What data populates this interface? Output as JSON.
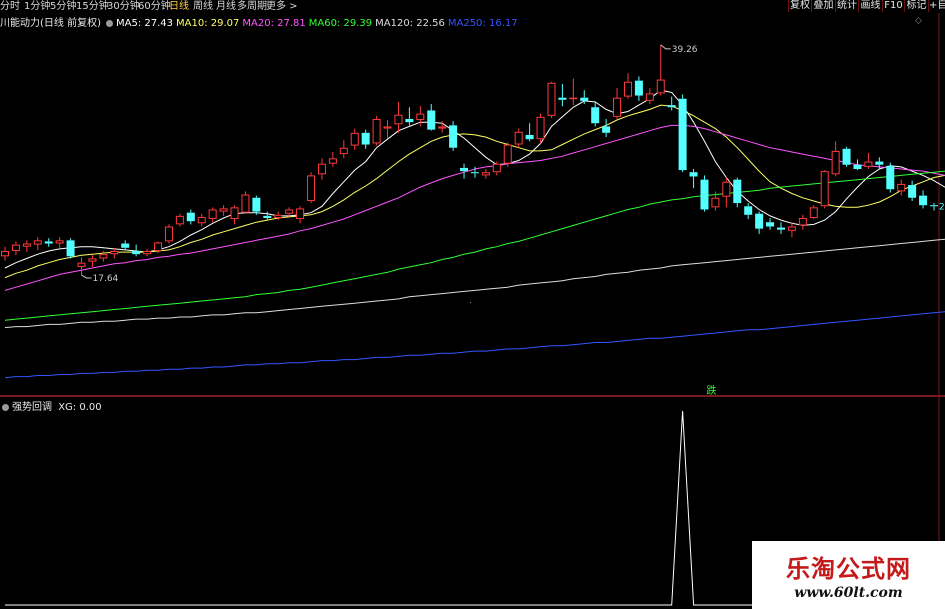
{
  "toolbar": {
    "periods": [
      "分时",
      "1分钟",
      "5分钟",
      "15分钟",
      "30分钟",
      "60分钟",
      "日线",
      "周线",
      "月线",
      "多周期",
      "更多 >"
    ],
    "active_period": "日线",
    "right_buttons": [
      "复权",
      "叠加",
      "统计",
      "画线",
      "F10",
      "标记",
      "+自"
    ]
  },
  "main_info": {
    "title": "川能动力(日线 前复权)",
    "ma": [
      {
        "label": "MA5: 27.43",
        "color": "#ffffff"
      },
      {
        "label": "MA10: 29.07",
        "color": "#ffff66"
      },
      {
        "label": "MA20: 27.81",
        "color": "#ff55ff"
      },
      {
        "label": "MA60: 29.39",
        "color": "#33ff33"
      },
      {
        "label": "MA120: 22.56",
        "color": "#dddddd"
      },
      {
        "label": "MA250: 16.17",
        "color": "#3355ff"
      }
    ]
  },
  "annotations": {
    "high": "39.26",
    "low": "17.64",
    "signal": "跌",
    "right_marker": "2"
  },
  "indicator": {
    "title": "强势回调",
    "value": "XG: 0.00"
  },
  "watermark": {
    "title": "乐淘公式网",
    "url": "www.60lt.com"
  },
  "chart_data": {
    "type": "candlestick",
    "candles": [
      {
        "o": 19.4,
        "h": 20.3,
        "l": 19.0,
        "c": 19.9
      },
      {
        "o": 19.9,
        "h": 20.8,
        "l": 19.5,
        "c": 20.5
      },
      {
        "o": 20.3,
        "h": 20.9,
        "l": 19.8,
        "c": 20.6
      },
      {
        "o": 20.5,
        "h": 21.2,
        "l": 20.0,
        "c": 20.9
      },
      {
        "o": 20.8,
        "h": 21.1,
        "l": 20.3,
        "c": 20.6
      },
      {
        "o": 20.6,
        "h": 21.2,
        "l": 20.2,
        "c": 20.9
      },
      {
        "o": 20.9,
        "h": 21.1,
        "l": 19.2,
        "c": 19.4
      },
      {
        "o": 18.4,
        "h": 19.3,
        "l": 17.64,
        "c": 18.8
      },
      {
        "o": 18.9,
        "h": 19.5,
        "l": 18.4,
        "c": 19.2
      },
      {
        "o": 19.2,
        "h": 19.9,
        "l": 18.9,
        "c": 19.6
      },
      {
        "o": 19.6,
        "h": 20.2,
        "l": 19.2,
        "c": 19.9
      },
      {
        "o": 20.6,
        "h": 20.9,
        "l": 20.0,
        "c": 20.2
      },
      {
        "o": 19.9,
        "h": 20.5,
        "l": 19.4,
        "c": 19.6
      },
      {
        "o": 19.6,
        "h": 20.1,
        "l": 19.4,
        "c": 19.9
      },
      {
        "o": 19.9,
        "h": 20.8,
        "l": 19.7,
        "c": 20.7
      },
      {
        "o": 20.8,
        "h": 22.4,
        "l": 20.6,
        "c": 22.2
      },
      {
        "o": 22.4,
        "h": 23.4,
        "l": 22.2,
        "c": 23.2
      },
      {
        "o": 23.5,
        "h": 23.8,
        "l": 22.4,
        "c": 22.7
      },
      {
        "o": 22.5,
        "h": 23.4,
        "l": 22.2,
        "c": 23.1
      },
      {
        "o": 22.9,
        "h": 24.0,
        "l": 22.6,
        "c": 23.8
      },
      {
        "o": 23.6,
        "h": 24.2,
        "l": 23.2,
        "c": 23.9
      },
      {
        "o": 22.9,
        "h": 24.2,
        "l": 22.4,
        "c": 24.0
      },
      {
        "o": 23.5,
        "h": 25.5,
        "l": 23.4,
        "c": 25.2
      },
      {
        "o": 24.9,
        "h": 25.1,
        "l": 23.3,
        "c": 23.6
      },
      {
        "o": 23.2,
        "h": 23.6,
        "l": 22.8,
        "c": 23.0
      },
      {
        "o": 23.0,
        "h": 23.6,
        "l": 22.8,
        "c": 23.3
      },
      {
        "o": 23.4,
        "h": 24.0,
        "l": 23.1,
        "c": 23.8
      },
      {
        "o": 22.9,
        "h": 24.1,
        "l": 22.5,
        "c": 23.9
      },
      {
        "o": 24.6,
        "h": 27.3,
        "l": 24.4,
        "c": 27.0
      },
      {
        "o": 27.1,
        "h": 28.6,
        "l": 26.6,
        "c": 28.1
      },
      {
        "o": 28.1,
        "h": 29.2,
        "l": 27.8,
        "c": 28.6
      },
      {
        "o": 29.0,
        "h": 30.3,
        "l": 28.6,
        "c": 29.6
      },
      {
        "o": 29.8,
        "h": 31.4,
        "l": 29.4,
        "c": 31.0
      },
      {
        "o": 31.0,
        "h": 31.3,
        "l": 29.5,
        "c": 29.9
      },
      {
        "o": 30.0,
        "h": 32.6,
        "l": 29.8,
        "c": 32.3
      },
      {
        "o": 31.4,
        "h": 32.2,
        "l": 30.5,
        "c": 31.6
      },
      {
        "o": 31.8,
        "h": 33.9,
        "l": 31.0,
        "c": 32.7
      },
      {
        "o": 32.3,
        "h": 33.4,
        "l": 31.7,
        "c": 32.0
      },
      {
        "o": 32.2,
        "h": 33.5,
        "l": 31.6,
        "c": 32.8
      },
      {
        "o": 33.1,
        "h": 33.7,
        "l": 31.2,
        "c": 31.3
      },
      {
        "o": 31.4,
        "h": 32.1,
        "l": 31.0,
        "c": 31.6
      },
      {
        "o": 31.7,
        "h": 32.1,
        "l": 29.3,
        "c": 29.6
      },
      {
        "o": 27.7,
        "h": 28.1,
        "l": 26.7,
        "c": 27.4
      },
      {
        "o": 27.3,
        "h": 27.8,
        "l": 26.8,
        "c": 27.2
      },
      {
        "o": 27.0,
        "h": 27.6,
        "l": 26.7,
        "c": 27.3
      },
      {
        "o": 27.3,
        "h": 28.3,
        "l": 27.0,
        "c": 28.1
      },
      {
        "o": 28.1,
        "h": 30.1,
        "l": 27.8,
        "c": 29.9
      },
      {
        "o": 29.9,
        "h": 31.4,
        "l": 29.6,
        "c": 31.1
      },
      {
        "o": 30.8,
        "h": 31.9,
        "l": 30.2,
        "c": 30.4
      },
      {
        "o": 30.4,
        "h": 32.8,
        "l": 30.0,
        "c": 32.5
      },
      {
        "o": 32.6,
        "h": 35.8,
        "l": 32.4,
        "c": 35.7
      },
      {
        "o": 34.3,
        "h": 35.6,
        "l": 33.5,
        "c": 34.1
      },
      {
        "o": 34.2,
        "h": 36.1,
        "l": 33.6,
        "c": 34.3
      },
      {
        "o": 34.3,
        "h": 35.0,
        "l": 33.7,
        "c": 34.0
      },
      {
        "o": 33.4,
        "h": 33.9,
        "l": 31.6,
        "c": 31.9
      },
      {
        "o": 31.6,
        "h": 32.3,
        "l": 30.6,
        "c": 31.0
      },
      {
        "o": 32.5,
        "h": 35.2,
        "l": 32.3,
        "c": 34.3
      },
      {
        "o": 34.4,
        "h": 36.6,
        "l": 34.2,
        "c": 35.8
      },
      {
        "o": 35.9,
        "h": 36.3,
        "l": 34.0,
        "c": 34.5
      },
      {
        "o": 34.0,
        "h": 35.2,
        "l": 33.7,
        "c": 34.7
      },
      {
        "o": 34.7,
        "h": 39.26,
        "l": 34.5,
        "c": 36.0
      },
      {
        "o": 33.6,
        "h": 34.4,
        "l": 33.1,
        "c": 33.4
      },
      {
        "o": 34.2,
        "h": 34.6,
        "l": 27.3,
        "c": 27.5
      },
      {
        "o": 27.3,
        "h": 27.6,
        "l": 25.8,
        "c": 26.9
      },
      {
        "o": 26.6,
        "h": 27.0,
        "l": 23.6,
        "c": 23.8
      },
      {
        "o": 24.0,
        "h": 25.5,
        "l": 23.7,
        "c": 24.9
      },
      {
        "o": 25.0,
        "h": 26.8,
        "l": 24.0,
        "c": 26.4
      },
      {
        "o": 26.6,
        "h": 26.8,
        "l": 24.0,
        "c": 24.4
      },
      {
        "o": 24.1,
        "h": 24.4,
        "l": 22.9,
        "c": 23.3
      },
      {
        "o": 23.4,
        "h": 23.6,
        "l": 21.5,
        "c": 22.0
      },
      {
        "o": 22.6,
        "h": 23.0,
        "l": 21.9,
        "c": 22.2
      },
      {
        "o": 22.1,
        "h": 22.6,
        "l": 21.5,
        "c": 21.9
      },
      {
        "o": 21.8,
        "h": 22.6,
        "l": 21.2,
        "c": 22.2
      },
      {
        "o": 22.3,
        "h": 23.3,
        "l": 21.9,
        "c": 23.0
      },
      {
        "o": 23.0,
        "h": 24.2,
        "l": 22.9,
        "c": 24.0
      },
      {
        "o": 24.1,
        "h": 27.5,
        "l": 23.9,
        "c": 27.4
      },
      {
        "o": 27.1,
        "h": 30.2,
        "l": 26.9,
        "c": 29.3
      },
      {
        "o": 29.5,
        "h": 29.7,
        "l": 27.8,
        "c": 28.0
      },
      {
        "o": 28.0,
        "h": 28.5,
        "l": 27.5,
        "c": 27.6
      },
      {
        "o": 27.8,
        "h": 29.1,
        "l": 27.6,
        "c": 28.3
      },
      {
        "o": 28.3,
        "h": 28.7,
        "l": 27.6,
        "c": 28.0
      },
      {
        "o": 27.9,
        "h": 28.2,
        "l": 25.4,
        "c": 25.7
      },
      {
        "o": 25.5,
        "h": 26.6,
        "l": 25.1,
        "c": 26.2
      },
      {
        "o": 26.1,
        "h": 26.5,
        "l": 24.6,
        "c": 24.9
      },
      {
        "o": 25.1,
        "h": 25.6,
        "l": 23.9,
        "c": 24.2
      },
      {
        "o": 24.2,
        "h": 24.4,
        "l": 23.7,
        "c": 24.1
      }
    ],
    "ma_series": [
      {
        "name": "MA5",
        "color": "#ffffff",
        "values": [
          18.3,
          18.8,
          19.2,
          19.6,
          19.9,
          20.1,
          20.2,
          20.3,
          20.3,
          20.2,
          20.1,
          20.0,
          19.9,
          19.8,
          20.0,
          20.3,
          20.8,
          21.4,
          21.9,
          22.5,
          23.0,
          23.4,
          23.5,
          23.5,
          23.4,
          23.2,
          23.2,
          23.3,
          23.5,
          24.1,
          25.3,
          26.4,
          27.5,
          28.3,
          29.6,
          30.4,
          31.2,
          31.6,
          32.0,
          32.0,
          31.9,
          31.2,
          30.5,
          29.6,
          28.7,
          28.0,
          28.1,
          28.4,
          29.0,
          30.0,
          31.6,
          32.5,
          33.4,
          34.0,
          33.9,
          33.2,
          32.8,
          33.0,
          33.6,
          34.2,
          35.0,
          34.8,
          33.6,
          32.0,
          30.2,
          28.3,
          26.8,
          25.5,
          24.6,
          23.8,
          23.2,
          22.8,
          22.5,
          22.3,
          22.4,
          22.8,
          23.6,
          24.8,
          25.9,
          26.9,
          27.6,
          27.9,
          27.8,
          27.4,
          27.0,
          26.5,
          25.9,
          25.3,
          24.9,
          24.6,
          24.4
        ]
      },
      {
        "name": "MA10",
        "color": "#ffff66",
        "values": [
          17.4,
          17.8,
          18.1,
          18.5,
          18.8,
          19.1,
          19.3,
          19.5,
          19.6,
          19.7,
          19.8,
          19.8,
          19.8,
          19.8,
          19.9,
          20.0,
          20.3,
          20.7,
          21.0,
          21.4,
          21.7,
          22.0,
          22.3,
          22.6,
          22.8,
          23.0,
          23.1,
          23.2,
          23.3,
          23.6,
          24.1,
          24.7,
          25.4,
          26.0,
          26.7,
          27.5,
          28.3,
          29.0,
          29.6,
          30.2,
          30.6,
          30.8,
          30.9,
          30.8,
          30.6,
          30.2,
          29.9,
          29.6,
          29.3,
          29.3,
          29.4,
          29.9,
          30.4,
          30.9,
          31.3,
          31.7,
          32.2,
          32.6,
          32.9,
          33.2,
          33.6,
          33.5,
          33.1,
          32.6,
          32.0,
          31.4,
          30.6,
          29.6,
          28.5,
          27.4,
          26.4,
          25.8,
          25.3,
          24.9,
          24.6,
          24.3,
          24.1,
          24.0,
          24.0,
          24.2,
          24.5,
          25.0,
          25.6,
          26.0,
          26.4,
          26.8,
          27.0,
          27.0,
          26.9,
          26.8,
          26.7
        ]
      },
      {
        "name": "MA20",
        "color": "#ff55ff",
        "values": [
          16.2,
          16.5,
          16.8,
          17.1,
          17.4,
          17.7,
          17.9,
          18.1,
          18.3,
          18.5,
          18.7,
          18.8,
          19.0,
          19.1,
          19.3,
          19.4,
          19.6,
          19.7,
          19.9,
          20.1,
          20.3,
          20.5,
          20.7,
          20.9,
          21.1,
          21.3,
          21.5,
          21.8,
          22.0,
          22.3,
          22.6,
          22.9,
          23.3,
          23.7,
          24.1,
          24.5,
          24.9,
          25.4,
          25.9,
          26.3,
          26.7,
          27.0,
          27.3,
          27.6,
          27.8,
          27.9,
          28.1,
          28.2,
          28.3,
          28.4,
          28.6,
          28.8,
          29.1,
          29.4,
          29.7,
          30.0,
          30.3,
          30.6,
          30.9,
          31.2,
          31.5,
          31.7,
          31.7,
          31.6,
          31.4,
          31.1,
          30.8,
          30.5,
          30.2,
          29.9,
          29.6,
          29.4,
          29.2,
          29.0,
          28.8,
          28.6,
          28.4,
          28.2,
          28.0,
          27.9,
          27.8,
          27.7,
          27.6,
          27.5,
          27.4,
          27.2,
          27.0,
          26.8,
          26.6,
          26.4,
          26.2
        ]
      },
      {
        "name": "MA60",
        "color": "#33ff33",
        "values": [
          13.4,
          13.5,
          13.6,
          13.7,
          13.8,
          13.9,
          14.0,
          14.1,
          14.2,
          14.3,
          14.4,
          14.5,
          14.6,
          14.7,
          14.8,
          14.9,
          15.0,
          15.1,
          15.2,
          15.3,
          15.4,
          15.5,
          15.6,
          15.8,
          15.9,
          16.0,
          16.2,
          16.3,
          16.5,
          16.7,
          16.9,
          17.1,
          17.3,
          17.5,
          17.7,
          17.9,
          18.2,
          18.4,
          18.6,
          18.8,
          19.1,
          19.3,
          19.6,
          19.8,
          20.1,
          20.3,
          20.6,
          20.8,
          21.1,
          21.4,
          21.7,
          22.0,
          22.3,
          22.6,
          22.9,
          23.2,
          23.5,
          23.8,
          24.0,
          24.3,
          24.5,
          24.7,
          24.8,
          25.0,
          25.1,
          25.2,
          25.3,
          25.4,
          25.5,
          25.6,
          25.8,
          25.9,
          26.0,
          26.1,
          26.2,
          26.3,
          26.4,
          26.5,
          26.6,
          26.7,
          26.8,
          26.9,
          27.0,
          27.1,
          27.2,
          27.3,
          27.4,
          27.5,
          27.6,
          27.7,
          27.7
        ]
      },
      {
        "name": "MA120",
        "color": "#dddddd",
        "values": [
          12.7,
          12.8,
          12.8,
          12.9,
          13.0,
          13.0,
          13.1,
          13.2,
          13.2,
          13.3,
          13.3,
          13.4,
          13.5,
          13.5,
          13.6,
          13.6,
          13.7,
          13.7,
          13.8,
          13.9,
          13.9,
          14.0,
          14.1,
          14.1,
          14.2,
          14.3,
          14.4,
          14.5,
          14.6,
          14.7,
          14.8,
          14.9,
          15.0,
          15.1,
          15.2,
          15.3,
          15.4,
          15.6,
          15.7,
          15.8,
          15.9,
          16.0,
          16.1,
          16.2,
          16.3,
          16.4,
          16.5,
          16.7,
          16.8,
          16.9,
          17.0,
          17.1,
          17.3,
          17.4,
          17.5,
          17.7,
          17.8,
          17.9,
          18.1,
          18.2,
          18.3,
          18.5,
          18.6,
          18.7,
          18.8,
          18.9,
          19.0,
          19.1,
          19.2,
          19.3,
          19.4,
          19.5,
          19.6,
          19.7,
          19.8,
          19.9,
          20.0,
          20.1,
          20.2,
          20.3,
          20.4,
          20.5,
          20.6,
          20.7,
          20.8,
          20.9,
          21.0,
          21.1,
          21.2,
          21.3,
          21.4
        ]
      },
      {
        "name": "MA250",
        "color": "#3355ff",
        "values": [
          8.0,
          8.1,
          8.1,
          8.2,
          8.2,
          8.3,
          8.3,
          8.4,
          8.4,
          8.5,
          8.5,
          8.6,
          8.6,
          8.7,
          8.7,
          8.8,
          8.8,
          8.9,
          8.9,
          9.0,
          9.0,
          9.1,
          9.2,
          9.2,
          9.3,
          9.3,
          9.4,
          9.4,
          9.5,
          9.6,
          9.6,
          9.7,
          9.7,
          9.8,
          9.9,
          9.9,
          10.0,
          10.1,
          10.1,
          10.2,
          10.3,
          10.3,
          10.4,
          10.5,
          10.5,
          10.6,
          10.7,
          10.7,
          10.8,
          10.9,
          11.0,
          11.0,
          11.1,
          11.2,
          11.3,
          11.3,
          11.4,
          11.5,
          11.6,
          11.7,
          11.7,
          11.8,
          11.9,
          12.0,
          12.1,
          12.2,
          12.3,
          12.4,
          12.5,
          12.5,
          12.6,
          12.7,
          12.8,
          12.9,
          13.0,
          13.1,
          13.2,
          13.3,
          13.4,
          13.5,
          13.6,
          13.7,
          13.8,
          13.9,
          14.0,
          14.1,
          14.2,
          14.3,
          14.3,
          14.4,
          14.5
        ]
      }
    ],
    "xg_values_peak_index": 62,
    "xg_peak_value": 1
  }
}
